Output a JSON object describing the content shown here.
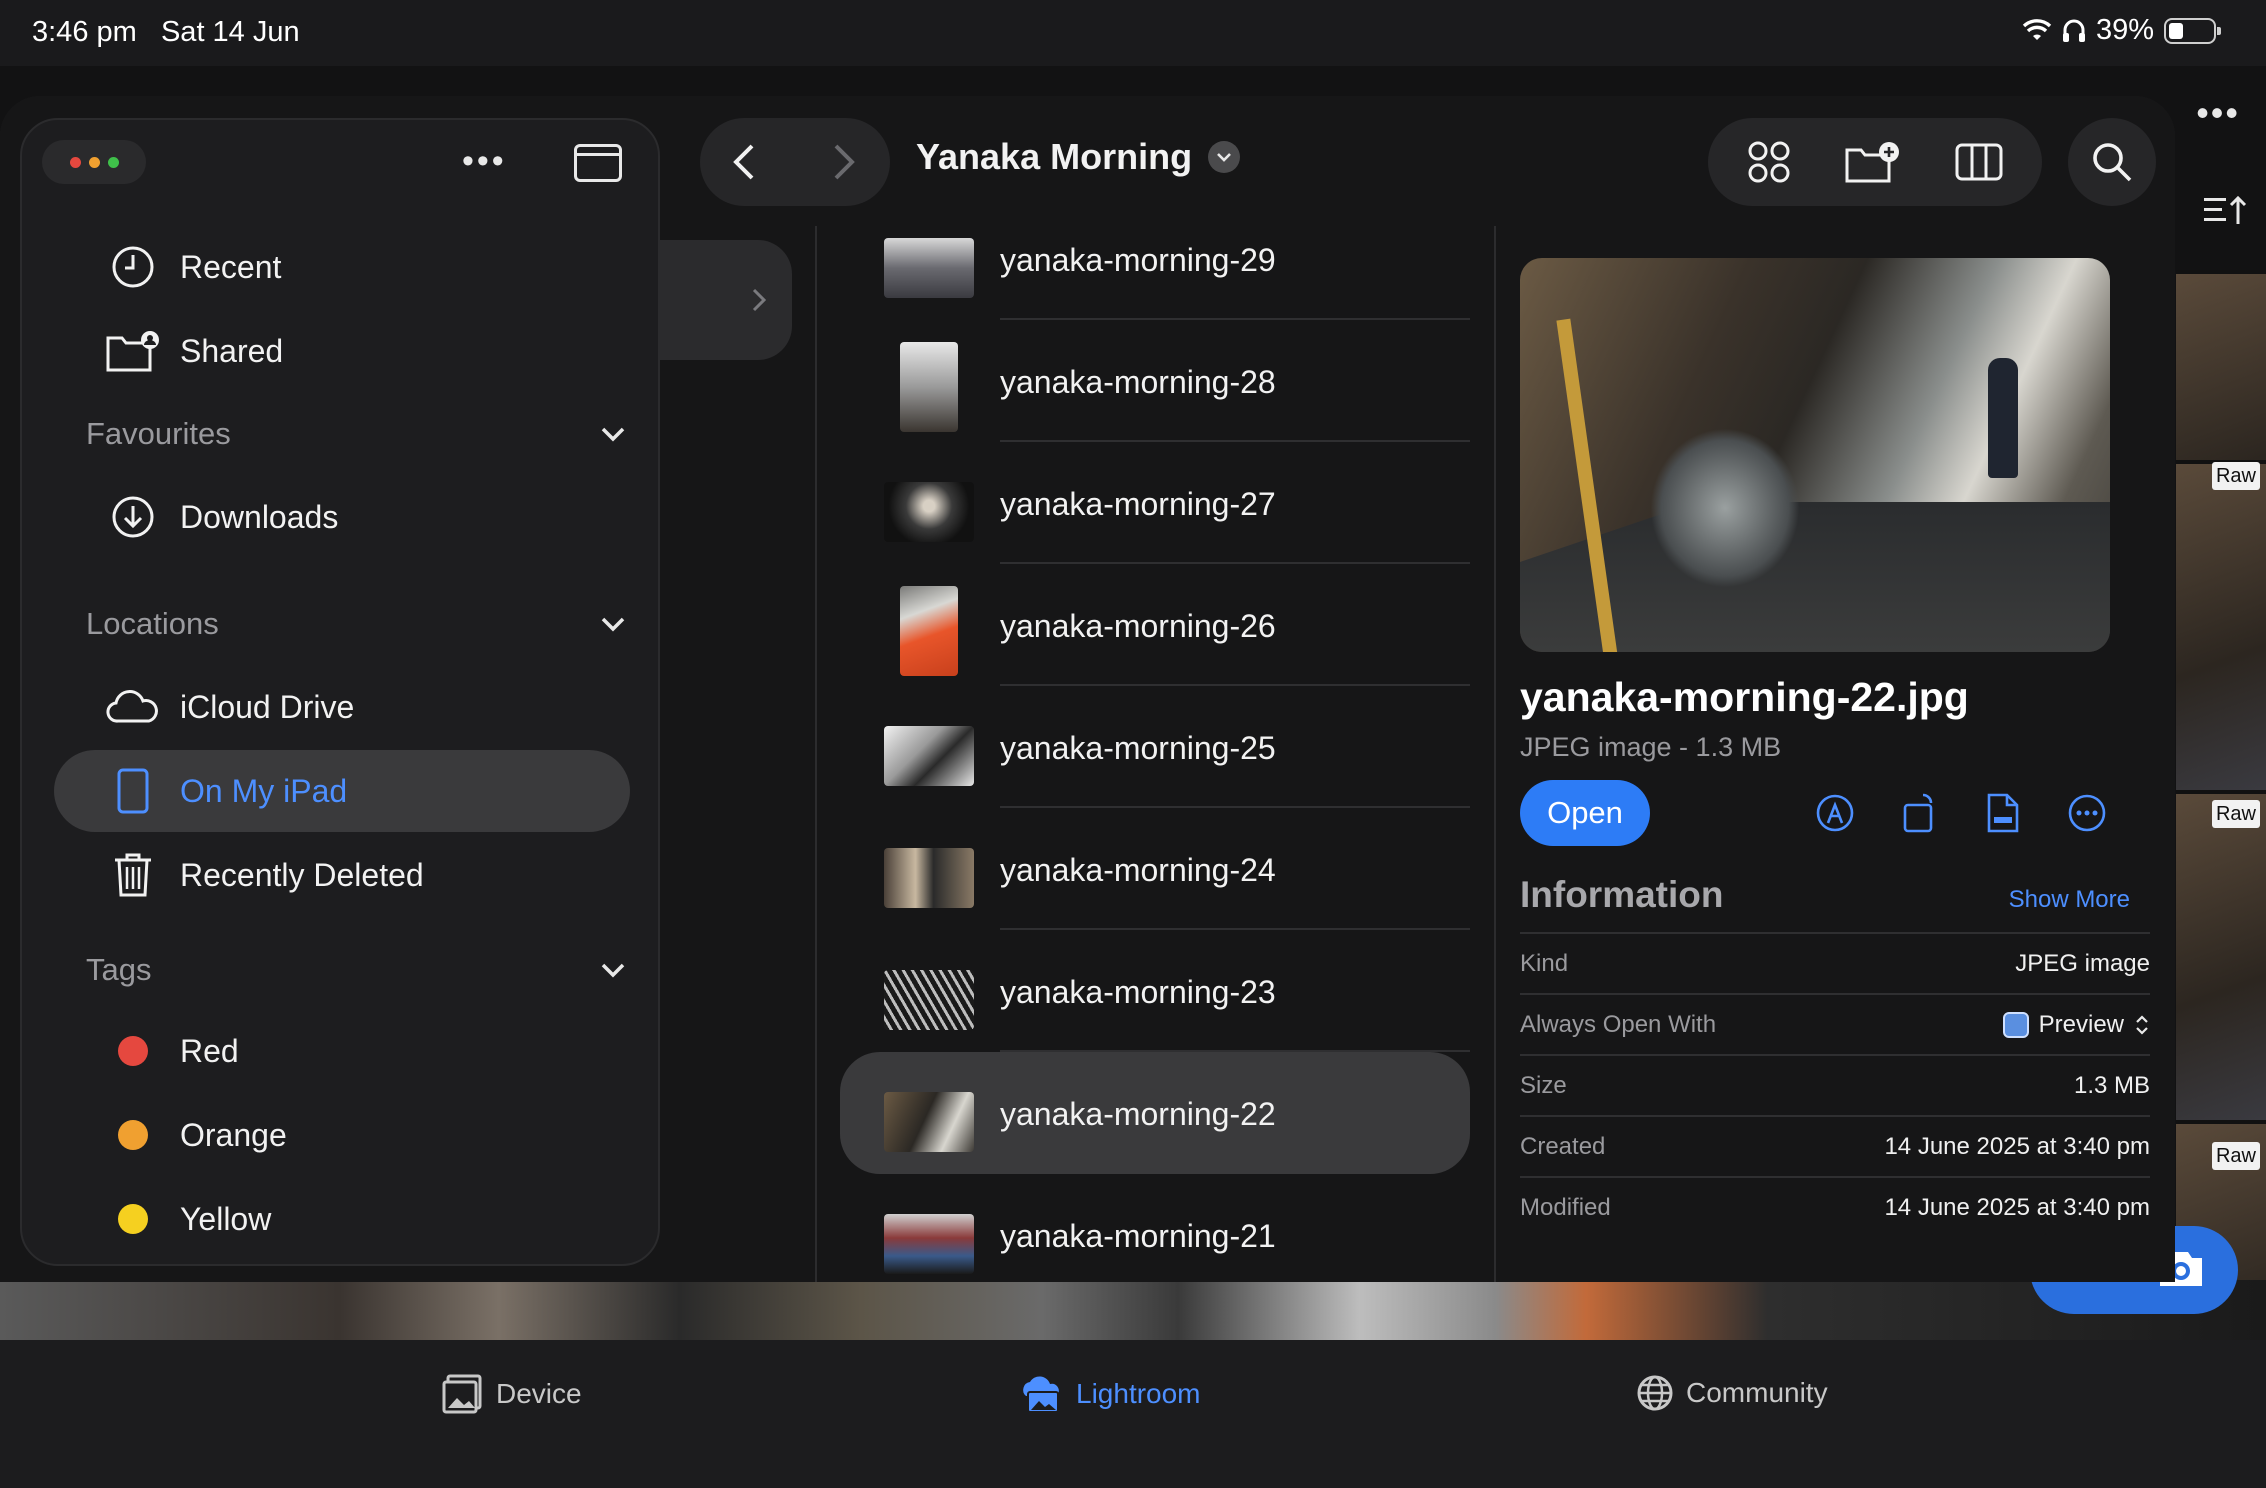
{
  "status": {
    "time": "3:46 pm",
    "date": "Sat 14 Jun",
    "battery": "39%"
  },
  "sidebar": {
    "items": [
      {
        "label": "Recent",
        "icon": "clock-icon"
      },
      {
        "label": "Shared",
        "icon": "shared-folder-icon"
      }
    ],
    "favourites": {
      "title": "Favourites",
      "items": [
        {
          "label": "Downloads",
          "icon": "download-icon"
        }
      ]
    },
    "locations": {
      "title": "Locations",
      "items": [
        {
          "label": "iCloud Drive",
          "icon": "cloud-icon"
        },
        {
          "label": "On My iPad",
          "icon": "ipad-icon",
          "selected": true
        },
        {
          "label": "Recently Deleted",
          "icon": "trash-icon"
        }
      ]
    },
    "tags": {
      "title": "Tags",
      "items": [
        {
          "label": "Red",
          "color": "#e5483f"
        },
        {
          "label": "Orange",
          "color": "#f0a030"
        },
        {
          "label": "Yellow",
          "color": "#f5d020"
        }
      ]
    }
  },
  "toolbar": {
    "folder_title": "Yanaka Morning"
  },
  "files": [
    {
      "name": "yanaka-morning-29"
    },
    {
      "name": "yanaka-morning-28"
    },
    {
      "name": "yanaka-morning-27"
    },
    {
      "name": "yanaka-morning-26"
    },
    {
      "name": "yanaka-morning-25"
    },
    {
      "name": "yanaka-morning-24"
    },
    {
      "name": "yanaka-morning-23"
    },
    {
      "name": "yanaka-morning-22",
      "selected": true
    },
    {
      "name": "yanaka-morning-21"
    }
  ],
  "preview": {
    "filename": "yanaka-morning-22.jpg",
    "type": "JPEG image - 1.3 MB",
    "open_label": "Open",
    "info_title": "Information",
    "show_more": "Show More",
    "info": [
      {
        "key": "Kind",
        "value": "JPEG image"
      },
      {
        "key": "Always Open With",
        "value": "Preview"
      },
      {
        "key": "Size",
        "value": "1.3 MB"
      },
      {
        "key": "Created",
        "value": "14 June 2025 at 3:40 pm"
      },
      {
        "key": "Modified",
        "value": "14 June 2025 at 3:40 pm"
      }
    ]
  },
  "lightroom": {
    "raw_badge": "Raw",
    "tabs": [
      {
        "label": "Device"
      },
      {
        "label": "Lightroom",
        "active": true
      },
      {
        "label": "Community"
      }
    ]
  }
}
